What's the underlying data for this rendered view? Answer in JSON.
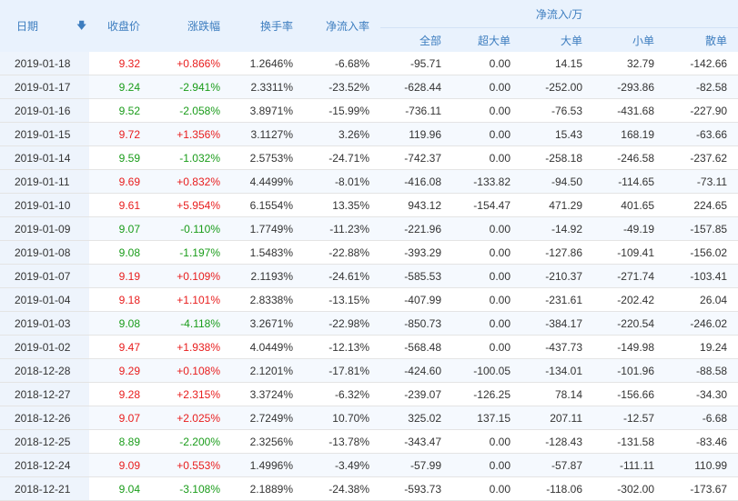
{
  "header": {
    "date": "日期",
    "close": "收盘价",
    "change": "涨跌幅",
    "turnover": "换手率",
    "net_ratio": "净流入率",
    "net_group": "净流入/万",
    "all": "全部",
    "super": "超大单",
    "large": "大单",
    "small": "小单",
    "retail": "散单",
    "sort_icon": "arrow-down-icon"
  },
  "colors": {
    "up": "#e81d1d",
    "down": "#1a9c1a",
    "header_text": "#3d7dbf",
    "header_bg": "#e9f2fd"
  },
  "rows": [
    {
      "date": "2019-01-18",
      "close": "9.32",
      "change": "+0.866%",
      "turnover": "1.2646%",
      "ratio": "-6.68%",
      "all": "-95.71",
      "super": "0.00",
      "large": "14.15",
      "small": "32.79",
      "retail": "-142.66",
      "dir": "up"
    },
    {
      "date": "2019-01-17",
      "close": "9.24",
      "change": "-2.941%",
      "turnover": "2.3311%",
      "ratio": "-23.52%",
      "all": "-628.44",
      "super": "0.00",
      "large": "-252.00",
      "small": "-293.86",
      "retail": "-82.58",
      "dir": "down"
    },
    {
      "date": "2019-01-16",
      "close": "9.52",
      "change": "-2.058%",
      "turnover": "3.8971%",
      "ratio": "-15.99%",
      "all": "-736.11",
      "super": "0.00",
      "large": "-76.53",
      "small": "-431.68",
      "retail": "-227.90",
      "dir": "down"
    },
    {
      "date": "2019-01-15",
      "close": "9.72",
      "change": "+1.356%",
      "turnover": "3.1127%",
      "ratio": "3.26%",
      "all": "119.96",
      "super": "0.00",
      "large": "15.43",
      "small": "168.19",
      "retail": "-63.66",
      "dir": "up"
    },
    {
      "date": "2019-01-14",
      "close": "9.59",
      "change": "-1.032%",
      "turnover": "2.5753%",
      "ratio": "-24.71%",
      "all": "-742.37",
      "super": "0.00",
      "large": "-258.18",
      "small": "-246.58",
      "retail": "-237.62",
      "dir": "down"
    },
    {
      "date": "2019-01-11",
      "close": "9.69",
      "change": "+0.832%",
      "turnover": "4.4499%",
      "ratio": "-8.01%",
      "all": "-416.08",
      "super": "-133.82",
      "large": "-94.50",
      "small": "-114.65",
      "retail": "-73.11",
      "dir": "up"
    },
    {
      "date": "2019-01-10",
      "close": "9.61",
      "change": "+5.954%",
      "turnover": "6.1554%",
      "ratio": "13.35%",
      "all": "943.12",
      "super": "-154.47",
      "large": "471.29",
      "small": "401.65",
      "retail": "224.65",
      "dir": "up"
    },
    {
      "date": "2019-01-09",
      "close": "9.07",
      "change": "-0.110%",
      "turnover": "1.7749%",
      "ratio": "-11.23%",
      "all": "-221.96",
      "super": "0.00",
      "large": "-14.92",
      "small": "-49.19",
      "retail": "-157.85",
      "dir": "down"
    },
    {
      "date": "2019-01-08",
      "close": "9.08",
      "change": "-1.197%",
      "turnover": "1.5483%",
      "ratio": "-22.88%",
      "all": "-393.29",
      "super": "0.00",
      "large": "-127.86",
      "small": "-109.41",
      "retail": "-156.02",
      "dir": "down"
    },
    {
      "date": "2019-01-07",
      "close": "9.19",
      "change": "+0.109%",
      "turnover": "2.1193%",
      "ratio": "-24.61%",
      "all": "-585.53",
      "super": "0.00",
      "large": "-210.37",
      "small": "-271.74",
      "retail": "-103.41",
      "dir": "up"
    },
    {
      "date": "2019-01-04",
      "close": "9.18",
      "change": "+1.101%",
      "turnover": "2.8338%",
      "ratio": "-13.15%",
      "all": "-407.99",
      "super": "0.00",
      "large": "-231.61",
      "small": "-202.42",
      "retail": "26.04",
      "dir": "up"
    },
    {
      "date": "2019-01-03",
      "close": "9.08",
      "change": "-4.118%",
      "turnover": "3.2671%",
      "ratio": "-22.98%",
      "all": "-850.73",
      "super": "0.00",
      "large": "-384.17",
      "small": "-220.54",
      "retail": "-246.02",
      "dir": "down"
    },
    {
      "date": "2019-01-02",
      "close": "9.47",
      "change": "+1.938%",
      "turnover": "4.0449%",
      "ratio": "-12.13%",
      "all": "-568.48",
      "super": "0.00",
      "large": "-437.73",
      "small": "-149.98",
      "retail": "19.24",
      "dir": "up"
    },
    {
      "date": "2018-12-28",
      "close": "9.29",
      "change": "+0.108%",
      "turnover": "2.1201%",
      "ratio": "-17.81%",
      "all": "-424.60",
      "super": "-100.05",
      "large": "-134.01",
      "small": "-101.96",
      "retail": "-88.58",
      "dir": "up"
    },
    {
      "date": "2018-12-27",
      "close": "9.28",
      "change": "+2.315%",
      "turnover": "3.3724%",
      "ratio": "-6.32%",
      "all": "-239.07",
      "super": "-126.25",
      "large": "78.14",
      "small": "-156.66",
      "retail": "-34.30",
      "dir": "up"
    },
    {
      "date": "2018-12-26",
      "close": "9.07",
      "change": "+2.025%",
      "turnover": "2.7249%",
      "ratio": "10.70%",
      "all": "325.02",
      "super": "137.15",
      "large": "207.11",
      "small": "-12.57",
      "retail": "-6.68",
      "dir": "up"
    },
    {
      "date": "2018-12-25",
      "close": "8.89",
      "change": "-2.200%",
      "turnover": "2.3256%",
      "ratio": "-13.78%",
      "all": "-343.47",
      "super": "0.00",
      "large": "-128.43",
      "small": "-131.58",
      "retail": "-83.46",
      "dir": "down"
    },
    {
      "date": "2018-12-24",
      "close": "9.09",
      "change": "+0.553%",
      "turnover": "1.4996%",
      "ratio": "-3.49%",
      "all": "-57.99",
      "super": "0.00",
      "large": "-57.87",
      "small": "-111.11",
      "retail": "110.99",
      "dir": "up"
    },
    {
      "date": "2018-12-21",
      "close": "9.04",
      "change": "-3.108%",
      "turnover": "2.1889%",
      "ratio": "-24.38%",
      "all": "-593.73",
      "super": "0.00",
      "large": "-118.06",
      "small": "-302.00",
      "retail": "-173.67",
      "dir": "down"
    }
  ]
}
